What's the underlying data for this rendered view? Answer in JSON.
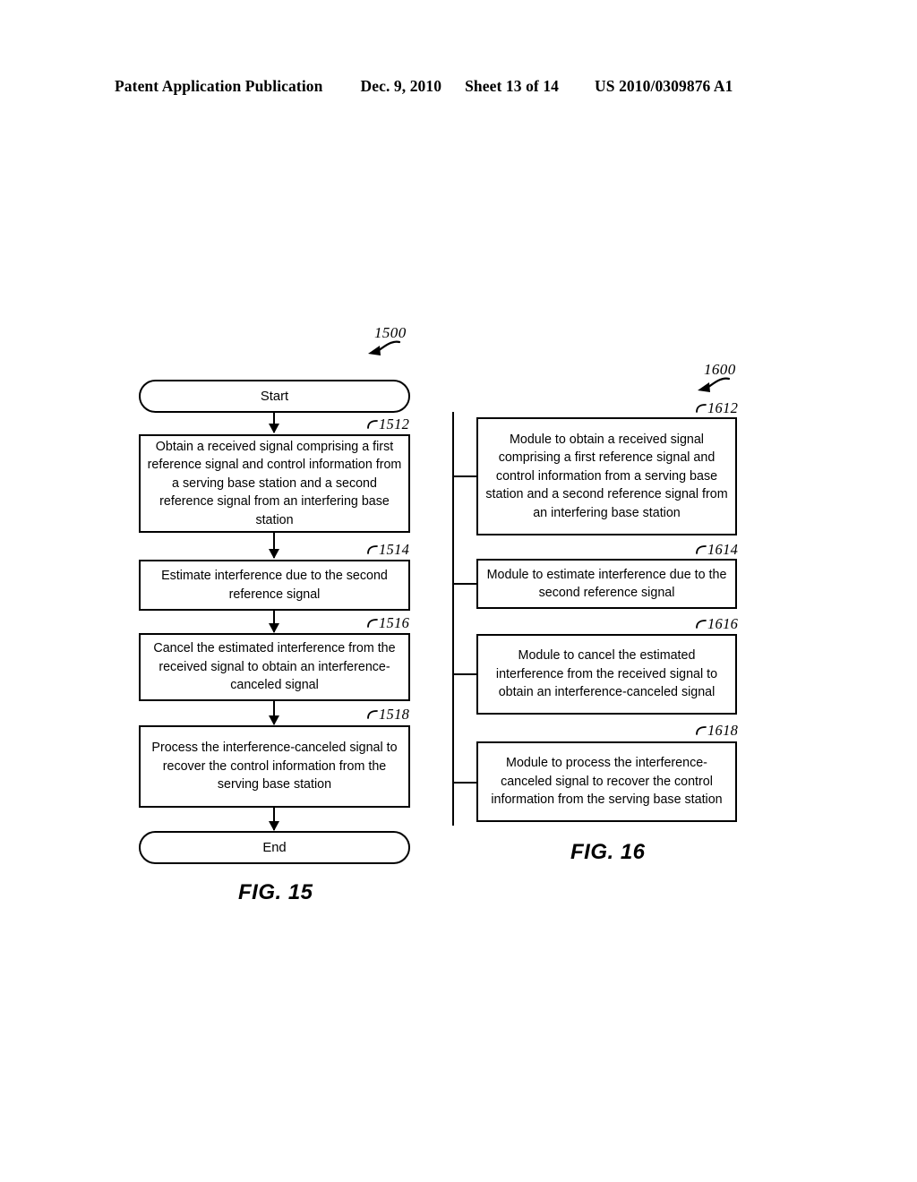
{
  "header": {
    "publication": "Patent Application Publication",
    "date": "Dec. 9, 2010",
    "sheet": "Sheet 13 of 14",
    "patent_number": "US 2010/0309876 A1"
  },
  "figures": [
    {
      "id": "fig15",
      "caption": "FIG. 15",
      "figure_ref": "1500",
      "nodes": [
        {
          "ref": "",
          "type": "terminator",
          "text": "Start"
        },
        {
          "ref": "1512",
          "type": "process",
          "text": "Obtain a received signal comprising a first reference signal and control information from a serving base station and a second reference signal from an interfering base station"
        },
        {
          "ref": "1514",
          "type": "process",
          "text": "Estimate interference due to the second reference signal"
        },
        {
          "ref": "1516",
          "type": "process",
          "text": "Cancel the estimated interference from the received signal to obtain an interference-canceled signal"
        },
        {
          "ref": "1518",
          "type": "process",
          "text": "Process the interference-canceled signal to recover the control information from the serving base station"
        },
        {
          "ref": "",
          "type": "terminator",
          "text": "End"
        }
      ]
    },
    {
      "id": "fig16",
      "caption": "FIG. 16",
      "figure_ref": "1600",
      "nodes": [
        {
          "ref": "1612",
          "type": "module",
          "text": "Module to obtain a received signal comprising a first reference signal and control information from a serving base station and a second reference signal from an interfering base station"
        },
        {
          "ref": "1614",
          "type": "module",
          "text": "Module to estimate interference due to the second reference signal"
        },
        {
          "ref": "1616",
          "type": "module",
          "text": "Module to cancel the estimated interference from the received signal to obtain an interference-canceled signal"
        },
        {
          "ref": "1618",
          "type": "module",
          "text": "Module to process the interference-canceled signal to recover the control information from the serving base station"
        }
      ]
    }
  ]
}
